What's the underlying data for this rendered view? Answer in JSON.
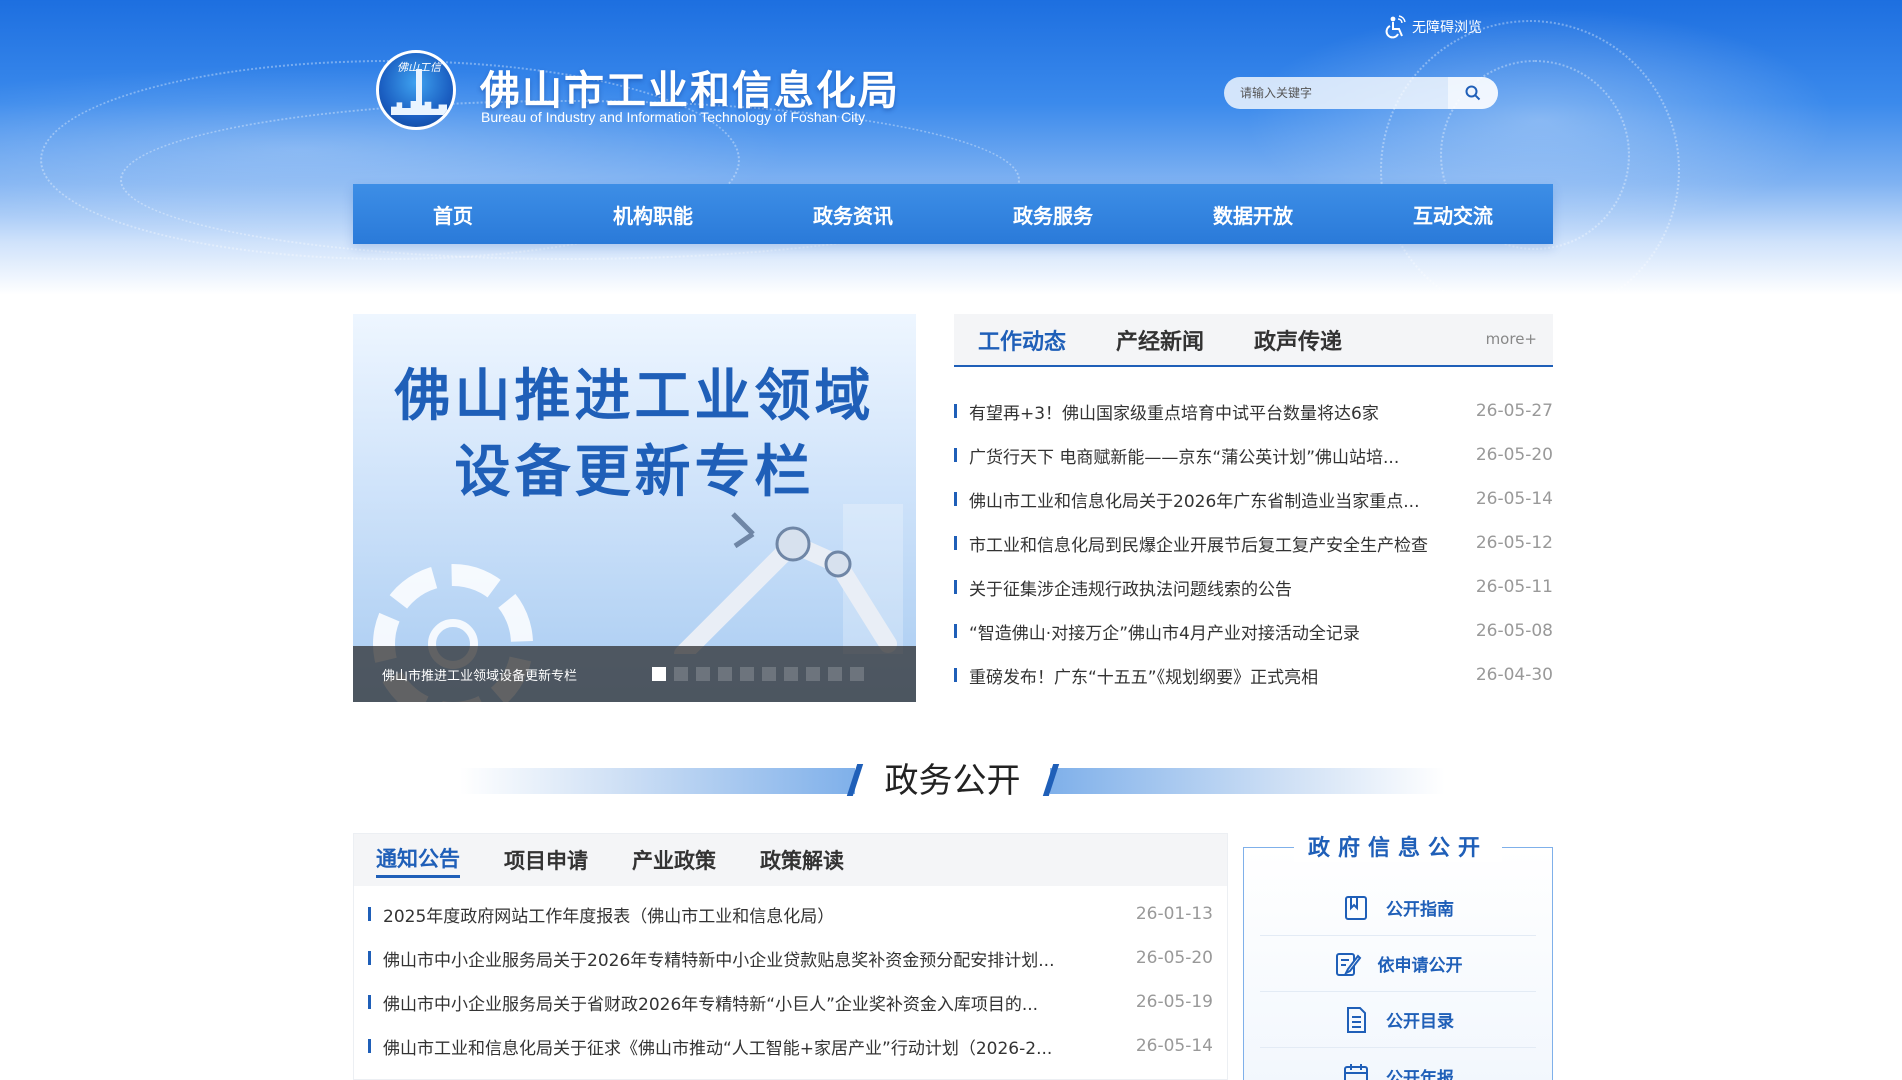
{
  "header": {
    "title": "佛山市工业和信息化局",
    "subtitle": "Bureau of Industry and Information Technology of Foshan City",
    "logo_text": "佛山工信",
    "accessibility": "无障碍浏览",
    "search_placeholder": "请输入关键字"
  },
  "nav": [
    "首页",
    "机构职能",
    "政务资讯",
    "政务服务",
    "数据开放",
    "互动交流"
  ],
  "slider": {
    "headline_line1": "佛山推进工业领域",
    "headline_line2": "设备更新专栏",
    "caption": "佛山市推进工业领域设备更新专栏",
    "dot_count": 10,
    "active_index": 0
  },
  "news": {
    "tabs": [
      "工作动态",
      "产经新闻",
      "政声传递"
    ],
    "active_tab": 0,
    "more": "more+",
    "items": [
      {
        "title": "有望再+3！佛山国家级重点培育中试平台数量将达6家",
        "date": "26-05-27"
      },
      {
        "title": "广货行天下 电商赋新能——京东“蒲公英计划”佛山站培...",
        "date": "26-05-20"
      },
      {
        "title": "佛山市工业和信息化局关于2026年广东省制造业当家重点...",
        "date": "26-05-14"
      },
      {
        "title": "市工业和信息化局到民爆企业开展节后复工复产安全生产检查",
        "date": "26-05-12"
      },
      {
        "title": "关于征集涉企违规行政执法问题线索的公告",
        "date": "26-05-11"
      },
      {
        "title": "“智造佛山·对接万企”佛山市4月产业对接活动全记录",
        "date": "26-05-08"
      },
      {
        "title": "重磅发布！广东“十五五”《规划纲要》正式亮相",
        "date": "26-04-30"
      }
    ]
  },
  "section": {
    "title": "政务公开"
  },
  "notice": {
    "tabs": [
      "通知公告",
      "项目申请",
      "产业政策",
      "政策解读"
    ],
    "active_tab": 0,
    "items": [
      {
        "title": "2025年度政府网站工作年度报表（佛山市工业和信息化局）",
        "date": "26-01-13"
      },
      {
        "title": "佛山市中小企业服务局关于2026年专精特新中小企业贷款贴息奖补资金预分配安排计划...",
        "date": "26-05-20"
      },
      {
        "title": "佛山市中小企业服务局关于省财政2026年专精特新“小巨人”企业奖补资金入库项目的...",
        "date": "26-05-19"
      },
      {
        "title": "佛山市工业和信息化局关于征求《佛山市推动“人工智能+家居产业”行动计划（2026-2...",
        "date": "26-05-14"
      }
    ]
  },
  "govinfo": {
    "title": "政府信息公开",
    "items": [
      {
        "label": "公开指南",
        "icon": "book-icon"
      },
      {
        "label": "依申请公开",
        "icon": "edit-document-icon"
      },
      {
        "label": "公开目录",
        "icon": "document-list-icon"
      },
      {
        "label": "公开年报",
        "icon": "calendar-icon"
      }
    ]
  },
  "colors": {
    "primary": "#1f5fb8",
    "nav": "#2a7ad9",
    "date": "#999999"
  }
}
